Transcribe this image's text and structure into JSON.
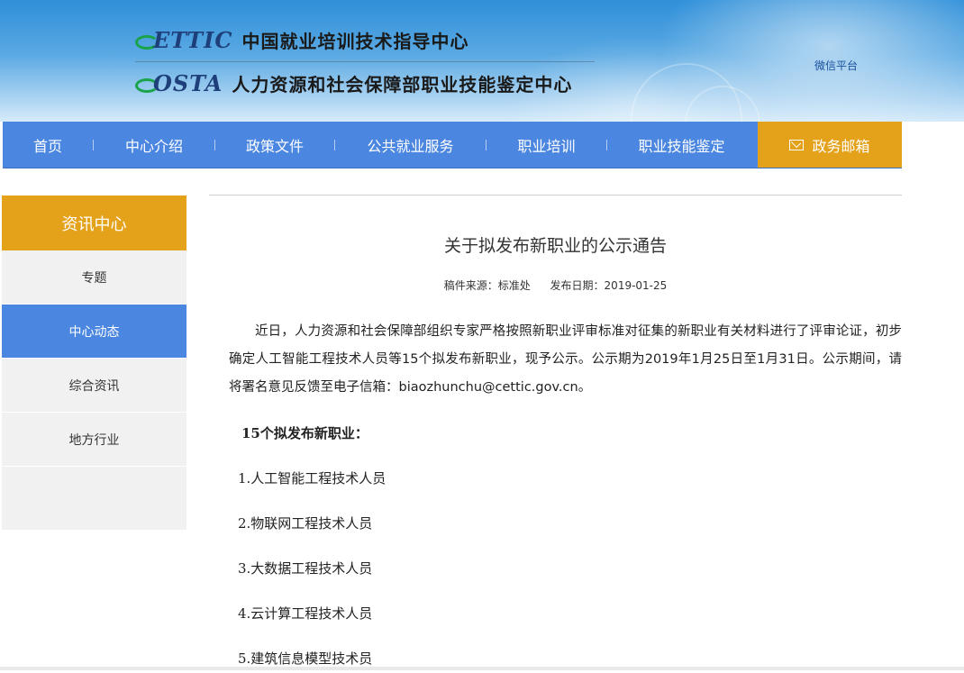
{
  "header": {
    "logo1_mark": "ETTIC",
    "logo1_title": "中国就业培训技术指导中心",
    "logo2_mark": "OSTA",
    "logo2_title": "人力资源和社会保障部职业技能鉴定中心",
    "wechat_label": "微信平台"
  },
  "nav": {
    "items": [
      "首页",
      "中心介绍",
      "政策文件",
      "公共就业服务",
      "职业培训",
      "职业技能鉴定"
    ],
    "mail_label": "政务邮箱"
  },
  "sidebar": {
    "title": "资讯中心",
    "items": [
      "专题",
      "中心动态",
      "综合资讯",
      "地方行业"
    ],
    "active_index": 1
  },
  "article": {
    "title": "关于拟发布新职业的公示通告",
    "source": "稿件来源：标准处",
    "date": "发布日期：2019-01-25",
    "paragraph": "近日，人力资源和社会保障部组织专家严格按照新职业评审标准对征集的新职业有关材料进行了评审论证，初步确定人工智能工程技术人员等15个拟发布新职业，现予公示。公示期为2019年1月25日至1月31日。公示期间，请将署名意见反馈至电子信箱：biaozhunchu@cettic.gov.cn。",
    "list_heading": "15个拟发布新职业：",
    "list": [
      "1.人工智能工程技术人员",
      "2.物联网工程技术人员",
      "3.大数据工程技术人员",
      "4.云计算工程技术人员",
      "5.建筑信息模型技术员"
    ]
  },
  "colors": {
    "nav_blue": "#4b86e0",
    "accent_orange": "#e4a21b",
    "sidebar_gray": "#f1f1f1"
  }
}
